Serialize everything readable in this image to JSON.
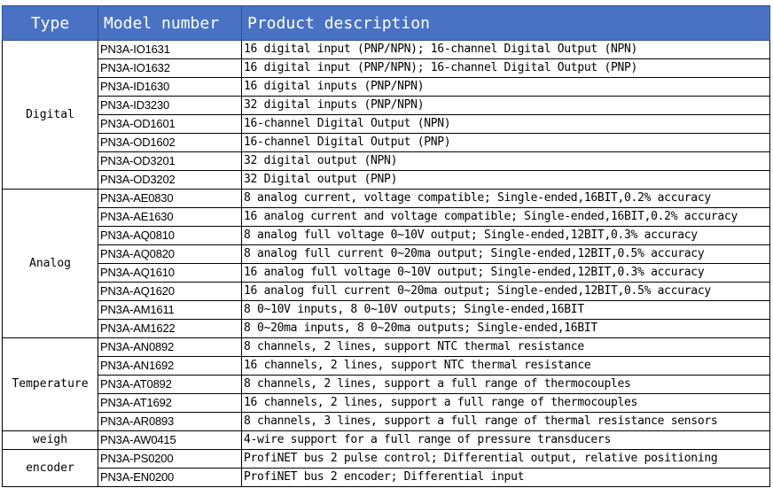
{
  "header": {
    "type": "Type",
    "model": "Model number",
    "description": "Product description"
  },
  "groups": [
    {
      "type": "Digital",
      "rows": [
        {
          "model": "PN3A-IO1631",
          "description": "16 digital input (PNP/NPN); 16-channel Digital Output (NPN)"
        },
        {
          "model": "PN3A-IO1632",
          "description": "16 digital input (PNP/NPN); 16-channel Digital Output (PNP)"
        },
        {
          "model": "PN3A-ID1630",
          "description": "16 digital inputs (PNP/NPN)"
        },
        {
          "model": "PN3A-ID3230",
          "description": "32 digital inputs (PNP/NPN)"
        },
        {
          "model": "PN3A-OD1601",
          "description": "16-channel Digital Output (NPN)"
        },
        {
          "model": "PN3A-OD1602",
          "description": "16-channel Digital Output (PNP)"
        },
        {
          "model": "PN3A-OD3201",
          "description": "32 digital output (NPN)"
        },
        {
          "model": "PN3A-OD3202",
          "description": "32 Digital output (PNP)"
        }
      ]
    },
    {
      "type": "Analog",
      "rows": [
        {
          "model": "PN3A-AE0830",
          "description": "8 analog current, voltage compatible; Single-ended,16BIT,0.2% accuracy"
        },
        {
          "model": "PN3A-AE1630",
          "description": "16 analog current and voltage compatible; Single-ended,16BIT,0.2% accuracy"
        },
        {
          "model": "PN3A-AQ0810",
          "description": "8 analog full voltage 0~10V output; Single-ended,12BIT,0.3% accuracy"
        },
        {
          "model": "PN3A-AQ0820",
          "description": "8 analog full current 0~20ma output; Single-ended,12BIT,0.5% accuracy"
        },
        {
          "model": "PN3A-AQ1610",
          "description": "16 analog full voltage 0~10V output; Single-ended,12BIT,0.3% accuracy"
        },
        {
          "model": "PN3A-AQ1620",
          "description": "16 analog full current 0~20ma output; Single-ended,12BIT,0.5% accuracy"
        },
        {
          "model": "PN3A-AM1611",
          "description": "8 0~10V inputs, 8 0~10V outputs; Single-ended,16BIT"
        },
        {
          "model": "PN3A-AM1622",
          "description": "8 0~20ma inputs, 8 0~20ma outputs; Single-ended,16BIT"
        }
      ]
    },
    {
      "type": "Temperature",
      "rows": [
        {
          "model": "PN3A-AN0892",
          "description": "8 channels, 2 lines, support NTC thermal resistance"
        },
        {
          "model": "PN3A-AN1692",
          "description": "16 channels, 2 lines, support NTC thermal resistance"
        },
        {
          "model": "PN3A-AT0892",
          "description": "8 channels, 2 lines, support a full range of thermocouples"
        },
        {
          "model": "PN3A-AT1692",
          "description": "16 channels, 2 lines, support a full range of thermocouples"
        },
        {
          "model": "PN3A-AR0893",
          "description": "8 channels, 3 lines, support a full range of thermal resistance sensors"
        }
      ]
    },
    {
      "type": "weigh",
      "rows": [
        {
          "model": "PN3A-AW0415",
          "description": "4-wire support for a full range of pressure transducers"
        }
      ]
    },
    {
      "type": "encoder",
      "rows": [
        {
          "model": "PN3A-PS0200",
          "description": "ProfiNET bus 2 pulse control; Differential output, relative positioning"
        },
        {
          "model": "PN3A-EN0200",
          "description": "ProfiNET bus 2 encoder; Differential input"
        }
      ]
    }
  ],
  "colors": {
    "header_bg": "#4a72c4",
    "header_text": "#ffffff",
    "border": "#000000"
  }
}
